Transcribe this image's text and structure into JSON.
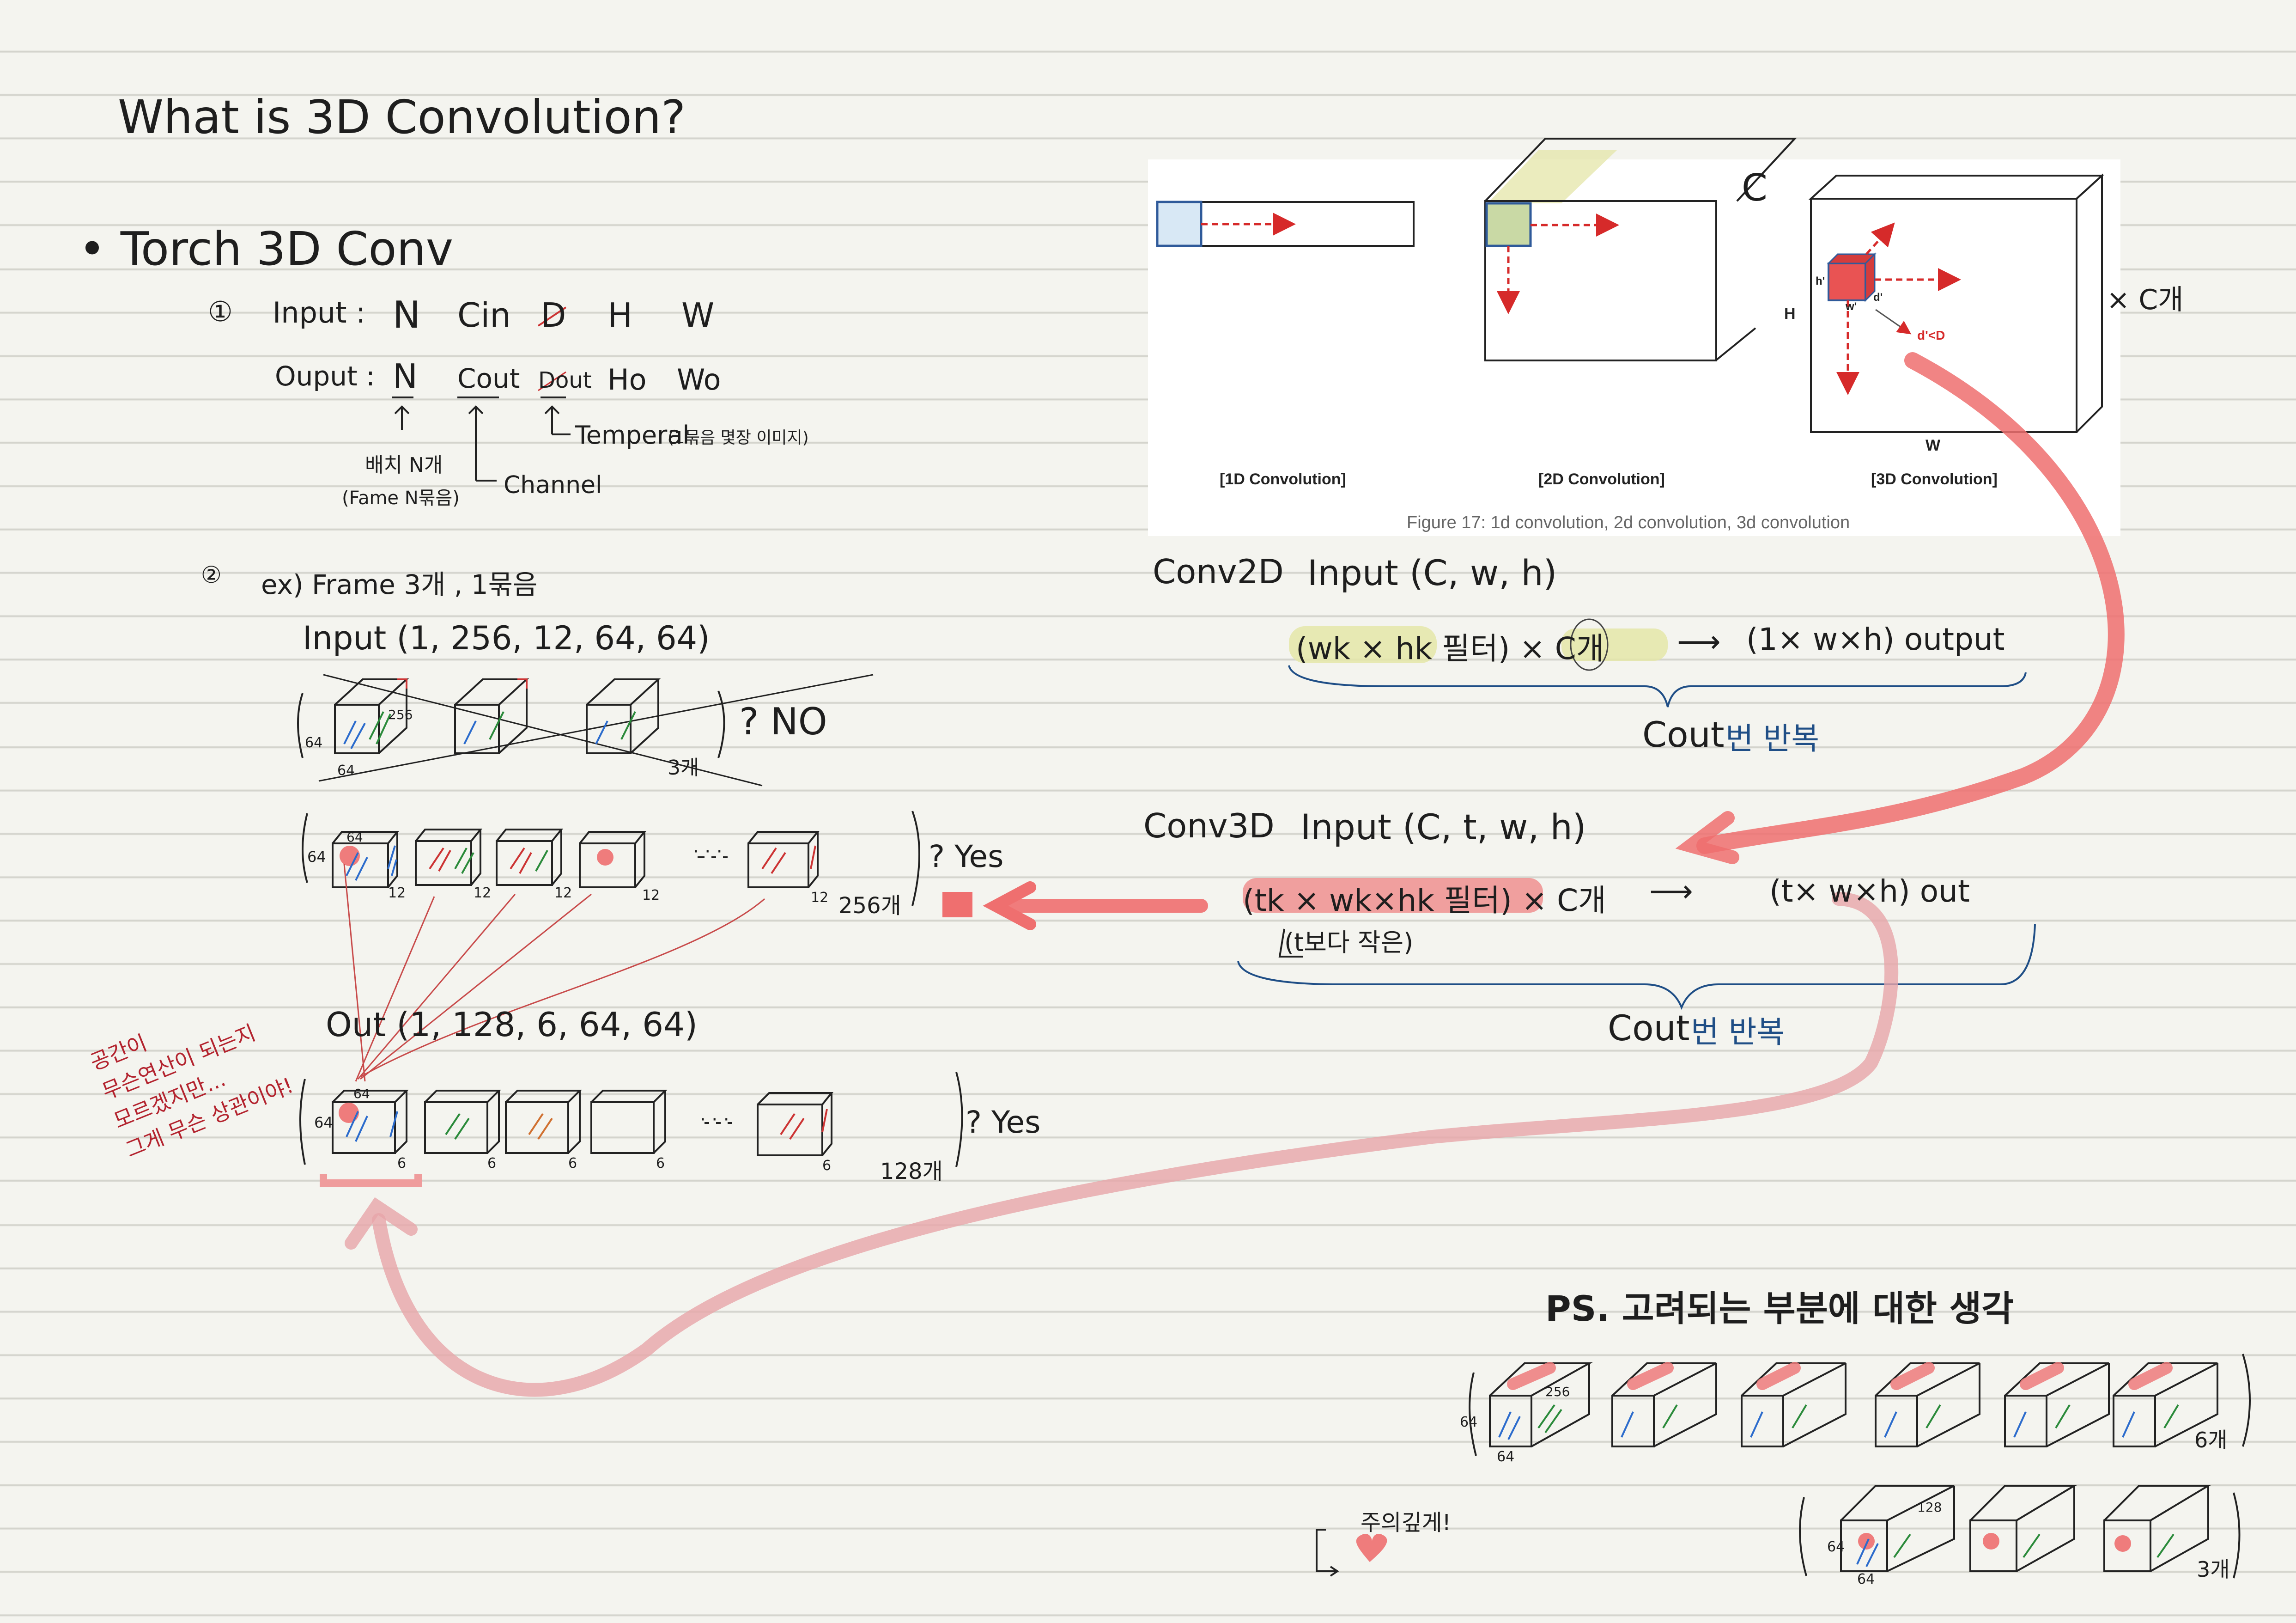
{
  "title": "What is 3D Convolution?",
  "section1": {
    "bullet": "Torch 3D Conv",
    "item1_marker": "①",
    "input_label": "Input :",
    "input_dims": [
      "N",
      "Cin",
      "D",
      "H",
      "W"
    ],
    "output_label": "Ouput :",
    "output_dims": [
      "N",
      "Cout",
      "Dout",
      "Ho",
      "Wo"
    ],
    "note_batch": "배치 N개",
    "note_batch_sub": "(Fame N묶음)",
    "note_channel": "Channel",
    "note_temporal": "Temperal",
    "note_temporal_sub": "(1묶음 몇장 이미지)"
  },
  "section2": {
    "item2_marker": "②",
    "example": "ex) Frame 3개 , 1묶음",
    "input_shape": "Input (1, 256, 12, 64, 64)",
    "wrong_answer": "? NO",
    "count_3": "3개",
    "count_256": "256개",
    "yes1": "? Yes",
    "output_shape": "Out (1, 128, 6, 64, 64)",
    "count_128": "128개",
    "yes2": "? Yes",
    "dots": "· · ·",
    "cube_labels": {
      "size64": "64",
      "size256": "256",
      "depth12": "12",
      "depth6": "6"
    },
    "red_note": [
      "공간이",
      "무슨연산이 되는지",
      "모르겠지만...",
      "그게 무슨 상관이야!"
    ]
  },
  "figure": {
    "labels": [
      "[1D Convolution]",
      "[2D Convolution]",
      "[3D Convolution]"
    ],
    "caption": "Figure 17: 1d convolution, 2d convolution, 3d convolution",
    "axis_H": "H",
    "axis_W": "W",
    "axis_C": "C",
    "cube_h": "h'",
    "cube_w": "w'",
    "cube_d": "d'",
    "cond": "d'<D",
    "times_c": "× C개"
  },
  "conv2d": {
    "label": "Conv2D",
    "input": "Input (C, w, h)",
    "formula": "(wk × hk 필터) × C개",
    "arrow": "⟶",
    "result": "(1× w×h) output",
    "repeat_c": "Cout",
    "repeat_text": "번 반복"
  },
  "conv3d": {
    "label": "Conv3D",
    "input": "Input (C, t, w, h)",
    "formula": "(tk × wk×hk 필터) × C개",
    "arrow": "⟶",
    "result": "(t× w×h) out",
    "note": "(t보다 작은)",
    "repeat_c": "Cout",
    "repeat_text": "번 반복"
  },
  "ps": {
    "title": "PS. 고려되는 부분에 대한 생각",
    "count_6": "6개",
    "count_3": "3개",
    "cube_labels": {
      "size64": "64",
      "size256": "256",
      "size128": "128"
    },
    "careful": "주의깊게!"
  },
  "colors": {
    "ink": "#1e1e1e",
    "red_highlight": "#ee7a7a",
    "yellow_highlight": "#e4e6a8",
    "blue_ink": "#1f4e86",
    "red_ink": "#b3232e"
  }
}
